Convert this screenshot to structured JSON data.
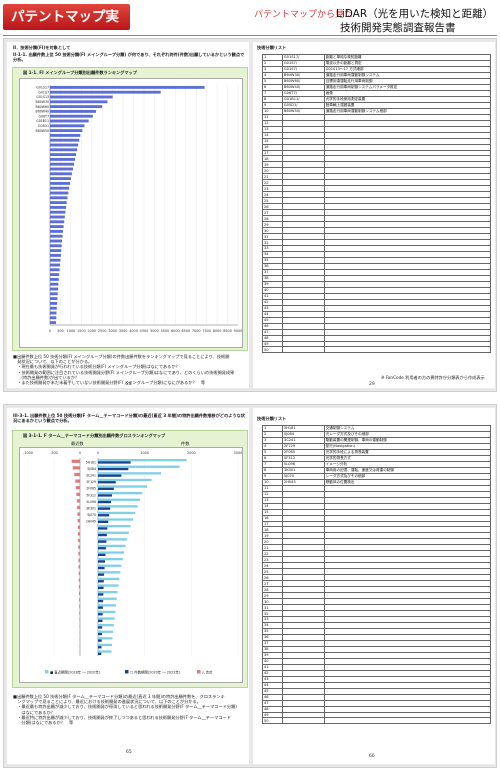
{
  "header": {
    "tab_label": "パテントマップ実例",
    "subtitle": "パテントマップから見た",
    "title_line1": "LiDAR（光を用いた検知と距離）",
    "title_line2": "技術開発実態調査報告書"
  },
  "page28": {
    "section": "II．技術分類(FI)を対象として",
    "heading": "II-1-1. 出願件数上位 50 技術分類(FI メイングループ分類) が何であり、それぞれ何件(件数)出願しているかという観点で分析。",
    "chart_caption": "図 1-1. FI メイングループ分類別出願件数ランキングマップ",
    "notes": [
      "■出願件数上位 50 技術分類(FI メイングループ分類)の件数出願件数をランキングマップで見ることにより、技術開",
      "　発状況について、以下のことが分かる。",
      "　・現在最も技術開発が行われている技術分類(FI メイングループ分類)はなにであるか？",
      "　・技術開発の範囲に注目されている技術開発分野(FI メイングループ分類)はなにであり、どのくらいの技術開発成果",
      "　　(特許出願件数)が出ているか？",
      "　・また技術開発が未だ未着手していない技術開発分野(FI メイングループ分類)になにがあるか？　等"
    ],
    "page_number": "28"
  },
  "page29": {
    "heading": "技術分類リスト",
    "rows": [
      [
        "1",
        "G01S17/",
        "距離と単純な検知距離"
      ],
      [
        "2",
        "G01S7/",
        "電波以外の距離と測定"
      ],
      [
        "3",
        "G01S7/",
        "G01S13～17 方式細部"
      ],
      [
        "4",
        "B60W30/",
        "道路走行用車両運動制御システム"
      ],
      [
        "5",
        "B60W60/",
        "目標到達運転走行用車両制御"
      ],
      [
        "6",
        "B60W40/",
        "道路走行用車両制御システムパラメータ推定"
      ],
      [
        "7",
        "G06T7/",
        "画像"
      ],
      [
        "8",
        "G01B11/",
        "光学的手段使用測定装置"
      ],
      [
        "9",
        "G05D1/",
        "陸車輌上運搬装置"
      ],
      [
        "10",
        "B60W50/",
        "道路走行用車両運動制御システム細部"
      ]
    ],
    "total_rows": 50,
    "footnote": "※ FanCode 利用者の方の異特許庁分類表から作成表示",
    "page_number": "29"
  },
  "page65": {
    "heading": "III-3-1. 出願件数上位 50 技術分類(F ターム__テーマコード分類)の最近(直近 3 年間)の特許出願件数推移がどのような状況にあるかという観点で分析。",
    "chart_caption": "図 3-1-1. F ターム__テーマコード分類別出願件数グロスランキングマップ",
    "left_axis_title": "最近数",
    "right_axis_title": "件数",
    "legend": [
      "■ 直近期間(2018年 ～ 2020年)",
      "□ 件数期間(2020年 ～ 2022年)",
      "△ 合計"
    ],
    "notes": [
      "■出願件数上位 50 技術分類(F ターム__テーマコード分類)の最近(直近 3 年間)の特許出願件数を、グロスランキ",
      "　ングマップで見ることにより、最近における技術開発の進展状況について、以下のことが分かる。",
      "　・最近最も特許出願が減少しており、技術開発が停滞していると思われる技術開発分野(F ターム__テーマコード分類)",
      "　　はなにであるか？",
      "　・最近特に特許出願が減少しており、技術開発が終了しつつあると思われる技術開発分野(F ターム__テーマコード",
      "　　分類)はなにであるか？　等"
    ],
    "page_number": "65"
  },
  "page66": {
    "heading": "技術分類リスト",
    "rows": [
      [
        "1",
        "5H181",
        "交通制御システム"
      ],
      [
        "2",
        "5J084",
        "光レーダ方式及びその細部"
      ],
      [
        "3",
        "3C241",
        "駆動装置の関連制御、車両の運動制御"
      ],
      [
        "4",
        "2F129",
        "航行(Navigation)"
      ],
      [
        "5",
        "2F065",
        "光学的手段による測長装置"
      ],
      [
        "6",
        "5F312",
        "光学的測長方式"
      ],
      [
        "7",
        "5L096",
        "イメージ分析"
      ],
      [
        "8",
        "3K301",
        "車両用の記憶、運転、速度又は荷重の制御"
      ],
      [
        "9",
        "5J070",
        "レーダ方式及びその細部"
      ],
      [
        "10",
        "2H045",
        "移動体の位置検出"
      ]
    ],
    "total_rows": 50,
    "page_number": "66"
  },
  "chart_data": [
    {
      "type": "bar",
      "orientation": "horizontal",
      "title": "図 1-1. FI メイングループ分類別出願件数ランキングマップ",
      "xlim": [
        0,
        9000
      ],
      "xticks": [
        0,
        500,
        1000,
        1500,
        2000,
        2500,
        3000,
        3500,
        4000,
        4500,
        5000,
        5500,
        6000,
        6500,
        7000,
        7500,
        8000,
        8500,
        9000
      ],
      "xtick_labels": [
        "0",
        "500",
        "1000",
        "1500",
        "2000",
        "2500",
        "3000",
        "3500",
        "4000",
        "4500",
        "5000",
        "5500",
        "6000",
        "6500",
        "7000",
        "7500",
        "8000",
        "8500",
        "9000"
      ],
      "categories": [
        "G01S17",
        "G01S7",
        "G01S13",
        "B60W30",
        "B60W60",
        "B60W40",
        "G06T7",
        "G01B11",
        "G05D1",
        "B60W50"
      ],
      "values": [
        7400,
        5300,
        3000,
        2750,
        2500,
        2200,
        2050,
        1850,
        1650,
        1550,
        1450,
        1400,
        1350,
        1300,
        1250,
        1200,
        1150,
        1100,
        1050,
        1000,
        960,
        920,
        880,
        840,
        800,
        770,
        740,
        710,
        680,
        650,
        620,
        600,
        580,
        560,
        540,
        520,
        500,
        480,
        460,
        440,
        420,
        400,
        385,
        370,
        355,
        340,
        325,
        310,
        300,
        290
      ],
      "color": "#5b6fd6"
    },
    {
      "type": "bar",
      "orientation": "horizontal-diverging",
      "title": "図 3-1-1. F ターム__テーマコード分類別出願件数グロスランキングマップ",
      "left_xlim": [
        -1000,
        0
      ],
      "left_xticks": [
        -1000,
        -500,
        0
      ],
      "right_xlim": [
        0,
        3000
      ],
      "right_xticks": [
        0,
        1000,
        2000,
        3000
      ],
      "categories": [
        "5H181",
        "5J084",
        "3C241",
        "2F129",
        "2F065",
        "5F312",
        "5L096",
        "3K301",
        "5J070",
        "2H045"
      ],
      "series": [
        {
          "name": "直近期間(2018年 ～ 2020年)",
          "values": [
            1900,
            1750,
            1350,
            1150,
            1050,
            950,
            900,
            850,
            800,
            750,
            700,
            660,
            620,
            590,
            560,
            530,
            500,
            480,
            460,
            440,
            420,
            400,
            385,
            370,
            355,
            340,
            325,
            310,
            300,
            290
          ]
        },
        {
          "name": "件数期間(2020年 ～ 2022年)",
          "values": [
            700,
            650,
            500,
            380,
            340,
            300,
            280,
            260,
            240,
            220,
            200,
            190,
            180,
            170,
            160,
            150,
            140,
            130,
            125,
            120,
            115,
            110,
            105,
            100,
            95,
            90,
            85,
            80,
            75,
            70
          ]
        },
        {
          "name": "合計",
          "values": [
            -160,
            -140,
            -110,
            -90,
            -80,
            -70,
            -60,
            -55,
            -50,
            -45,
            -40,
            -38,
            -36,
            -34,
            -32,
            -30,
            -28,
            -26,
            -24,
            -22,
            -20,
            -18,
            -16,
            -14,
            -12,
            -10,
            -9,
            -8,
            -7,
            -6
          ]
        }
      ]
    }
  ]
}
